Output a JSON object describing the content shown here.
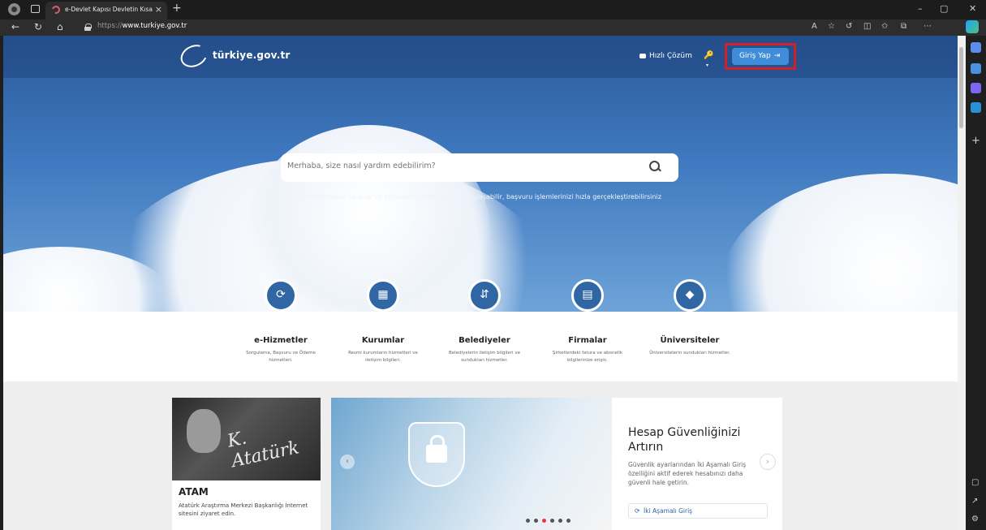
{
  "browser": {
    "tab_title": "e-Devlet Kapısı Devletin Kısayolu",
    "tab_close": "×",
    "new_tab": "+",
    "url_prefix": "https://",
    "url_domain": "www.turkiye.gov.tr",
    "win_min": "–",
    "win_max": "▢",
    "win_close": "✕"
  },
  "header": {
    "logo": "türkiye.gov.tr",
    "hizli_cozum": "Hızlı Çözüm",
    "giris_yap": "Giriş Yap"
  },
  "search": {
    "placeholder": "Merhaba, size nasıl yardım edebilirim?",
    "tagline": "e-Devlet Kapısı ile bilgi ve belgelerinize tek noktadan ulaşabilir, başvuru işlemlerinizi hızla gerçekleştirebilirsiniz"
  },
  "services": [
    {
      "title": "e-Hizmetler",
      "desc": "Sorgulama, Başvuru ve Ödeme hizmetleri."
    },
    {
      "title": "Kurumlar",
      "desc": "Resmi kurumların hizmetleri ve iletişim bilgileri."
    },
    {
      "title": "Belediyeler",
      "desc": "Belediyelerin iletişim bilgileri ve sundukları hizmetler."
    },
    {
      "title": "Firmalar",
      "desc": "Şirketlerdeki fatura ve abonelik bilgilerinize erişin."
    },
    {
      "title": "Üniversiteler",
      "desc": "Üniversitelerin sundukları hizmetler."
    }
  ],
  "atam": {
    "title": "ATAM",
    "desc": "Atatürk Araştırma Merkezi Başkanlığı İnternet sitesini ziyaret edin."
  },
  "promo": {
    "title": "Hesap Güvenliğinizi Artırın",
    "desc": "Güvenlik ayarlarından İki Aşamalı Giriş özelliğini aktif ederek hesabınızı daha güvenli hale getirin.",
    "link": "İki Aşamalı Giriş",
    "slide_count": 6,
    "active_slide": 3
  },
  "colors": {
    "primary": "#2f66a3",
    "login_button": "#3f8dd9",
    "highlight": "#d0202a"
  }
}
